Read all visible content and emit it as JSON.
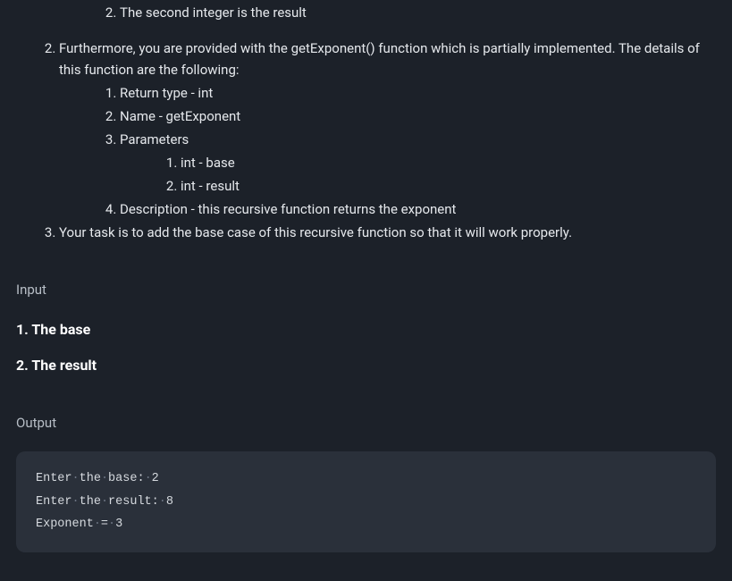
{
  "instructions": {
    "item_1_2_2": "The second integer is the result",
    "item_2": "Furthermore, you are provided with the getExponent() function which is partially implemented. The details of this function are the following:",
    "item_2_1": "Return type - int",
    "item_2_2": "Name - getExponent",
    "item_2_3": "Parameters",
    "item_2_3_1": "int - base",
    "item_2_3_2": "int - result",
    "item_2_4": "Description - this recursive function returns the exponent",
    "item_3": "Your task is to add the base case of this recursive function so that it will work properly."
  },
  "input_section": {
    "label": "Input",
    "line1": "1. The base",
    "line2": "2. The result"
  },
  "output_section": {
    "label": "Output",
    "code_lines": {
      "l1_a": "Enter",
      "l1_b": "the",
      "l1_c": "base:",
      "l1_d": "2",
      "l2_a": "Enter",
      "l2_b": "the",
      "l2_c": "result:",
      "l2_d": "8",
      "l3_a": "Exponent",
      "l3_b": "=",
      "l3_c": "3"
    }
  }
}
